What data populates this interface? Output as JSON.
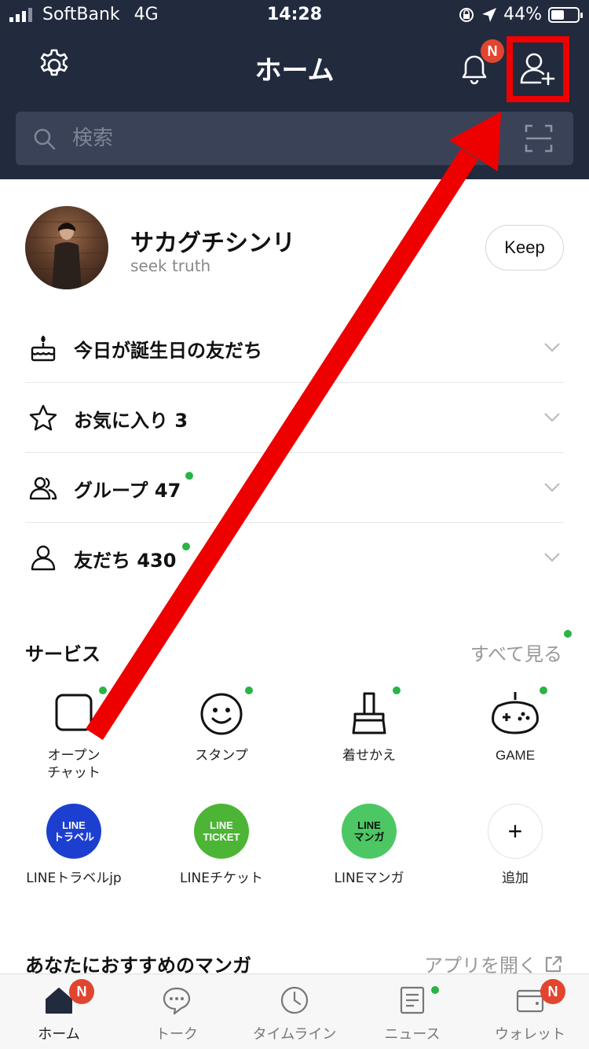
{
  "status_bar": {
    "carrier": "SoftBank",
    "network": "4G",
    "time": "14:28",
    "battery_percent": "44%",
    "battery_level": 0.44
  },
  "header": {
    "title": "ホーム",
    "notification_badge": "N"
  },
  "search": {
    "placeholder": "検索"
  },
  "profile": {
    "name": "サカグチシンリ",
    "status_message": "seek truth",
    "keep_label": "Keep"
  },
  "list": [
    {
      "label": "今日が誕生日の友だち",
      "icon": "cake-icon",
      "new_dot": false
    },
    {
      "label": "お気に入り 3",
      "icon": "star-icon",
      "new_dot": false
    },
    {
      "label": "グループ 47",
      "icon": "group-icon",
      "new_dot": true
    },
    {
      "label": "友だち 430",
      "icon": "person-icon",
      "new_dot": true
    }
  ],
  "services": {
    "title": "サービス",
    "see_all": "すべて見る",
    "row1": [
      {
        "label": "オープン\nチャット",
        "icon": "openchat-icon"
      },
      {
        "label": "スタンプ",
        "icon": "sticker-icon"
      },
      {
        "label": "着せかえ",
        "icon": "theme-icon"
      },
      {
        "label": "GAME",
        "icon": "game-icon"
      }
    ],
    "row2": [
      {
        "label": "LINEトラベルjp",
        "icon_text": "LINE\nトラベル",
        "color": "#1d3fd0"
      },
      {
        "label": "LINEチケット",
        "icon_text": "LINE\nTICKET",
        "color": "#4cb535"
      },
      {
        "label": "LINEマンガ",
        "icon_text": "LINE\nマンガ",
        "color": "#4cc764"
      },
      {
        "label": "追加",
        "icon_text": "+",
        "color": "#ffffff"
      }
    ]
  },
  "manga": {
    "title": "あなたにおすすめのマンガ",
    "open_app": "アプリを開く"
  },
  "tabs": [
    {
      "label": "ホーム",
      "icon": "home-icon",
      "badge": "N"
    },
    {
      "label": "トーク",
      "icon": "chat-icon"
    },
    {
      "label": "タイムライン",
      "icon": "clock-icon"
    },
    {
      "label": "ニュース",
      "icon": "news-icon"
    },
    {
      "label": "ウォレット",
      "icon": "wallet-icon",
      "badge": "N"
    }
  ],
  "colors": {
    "header_bg": "#222a3e",
    "badge_red": "#e2452f",
    "online_green": "#28b446",
    "highlight_red": "#ee0000"
  }
}
